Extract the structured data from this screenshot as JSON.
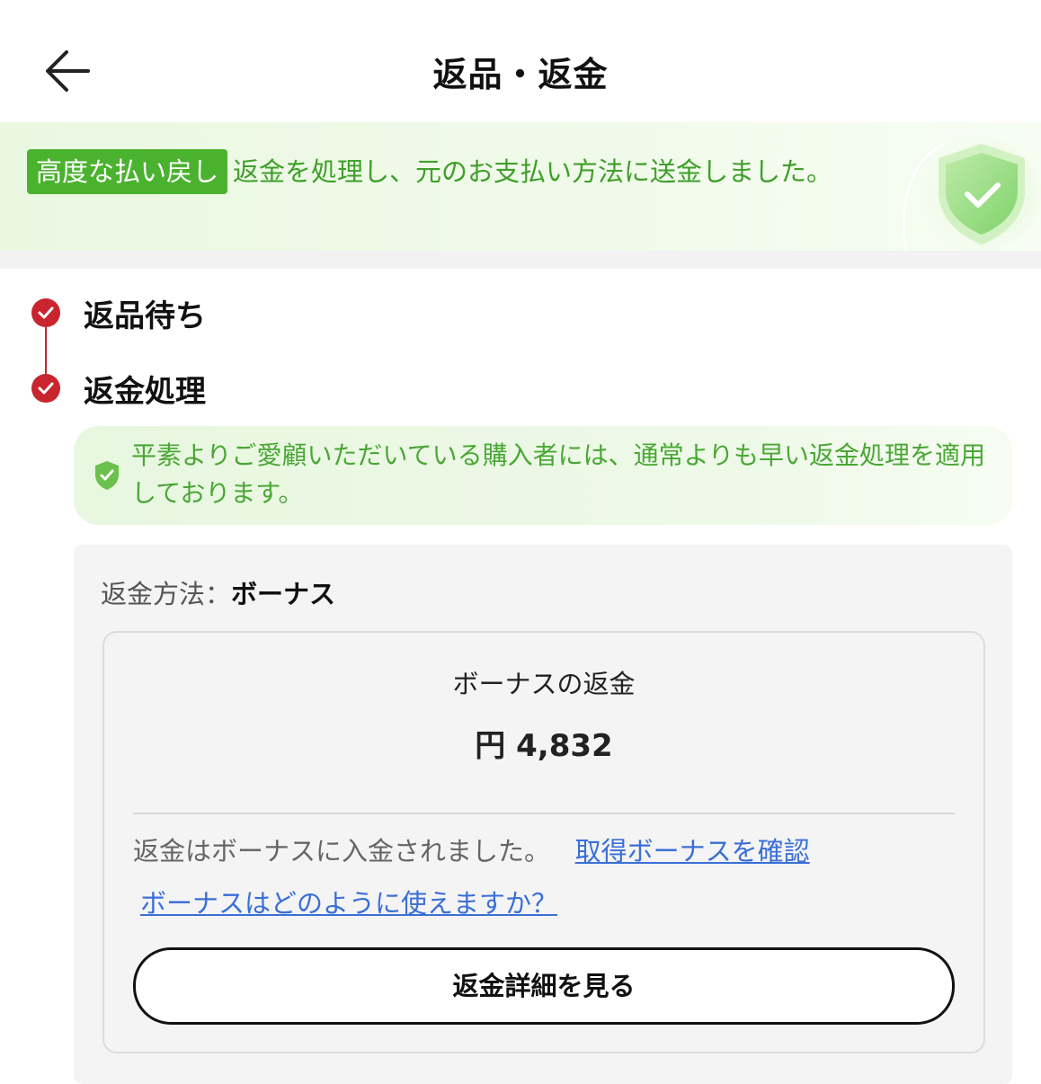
{
  "header": {
    "title": "返品・返金",
    "back_icon": "arrow-left-icon"
  },
  "banner": {
    "tag": "高度な払い戻し",
    "message": "返金を処理し、元のお支払い方法に送金しました。",
    "accent_color": "#4bb22f",
    "icon": "shield-check-icon"
  },
  "timeline": {
    "color": "#c8252f",
    "steps": [
      {
        "label": "返品待ち",
        "status": "done"
      },
      {
        "label": "返金処理",
        "status": "done"
      }
    ]
  },
  "notice": {
    "icon": "shield-check-icon",
    "text": "平素よりご愛顧いただいている購入者には、通常よりも早い返金処理を適用しております。"
  },
  "refund": {
    "method_label": "返金方法：",
    "method_value": "ボーナス",
    "bonus_title": "ボーナスの返金",
    "amount": "円 4,832",
    "credited_text": "返金はボーナスに入金されました。",
    "check_bonus_link": "取得ボーナスを確認",
    "how_to_use_link": "ボーナスはどのように使えますか？",
    "details_button": "返金詳細を見る"
  }
}
